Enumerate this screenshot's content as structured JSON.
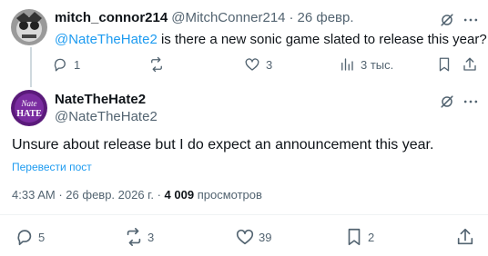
{
  "reply_tweet": {
    "display_name": "mitch_connor214",
    "handle": "@MitchConner214",
    "separator": "·",
    "date": "26 февр.",
    "mention": "@NateTheHate2",
    "text": " is there a new sonic game slated to release this year?",
    "replies": "1",
    "reposts": "",
    "likes": "3",
    "views": "3 тыс."
  },
  "main_tweet": {
    "display_name": "NateTheHate2",
    "handle": "@NateTheHate2",
    "avatar_text_top": "Nate",
    "avatar_text_bottom": "HATE",
    "text": "Unsure about release but I do expect an announcement this year.",
    "translate_label": "Перевести пост",
    "time": "4:33 AM",
    "separator": "·",
    "date": "26 февр. 2026 г.",
    "separator2": "·",
    "views_count": "4 009",
    "views_label": "просмотров",
    "replies": "5",
    "reposts": "3",
    "likes": "39",
    "bookmarks": "2"
  },
  "colors": {
    "accent": "#1d9bf0",
    "text": "#0f1419",
    "secondary": "#536471",
    "main_avatar_bg": "#5a1a7a"
  },
  "icons": {
    "grok": "grok-icon",
    "more": "more-icon",
    "reply": "reply-icon",
    "repost": "repost-icon",
    "like": "like-icon",
    "views": "views-icon",
    "bookmark": "bookmark-icon",
    "share": "share-icon"
  }
}
